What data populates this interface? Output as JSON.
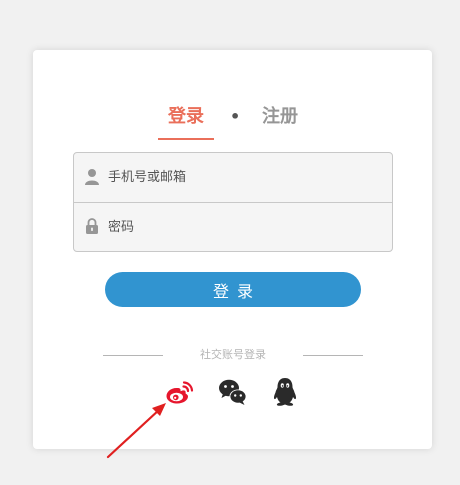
{
  "tabs": {
    "login": "登录",
    "separator": "•",
    "register": "注册"
  },
  "form": {
    "account_placeholder": "手机号或邮箱",
    "password_placeholder": "密码",
    "login_button": "登录"
  },
  "social": {
    "title": "社交账号登录",
    "icons": [
      "weibo-icon",
      "wechat-icon",
      "qq-icon"
    ]
  },
  "colors": {
    "accent": "#ea6f5a",
    "button": "#3194d0",
    "inactive_tab": "#969696",
    "annotation_arrow": "#e02020"
  }
}
